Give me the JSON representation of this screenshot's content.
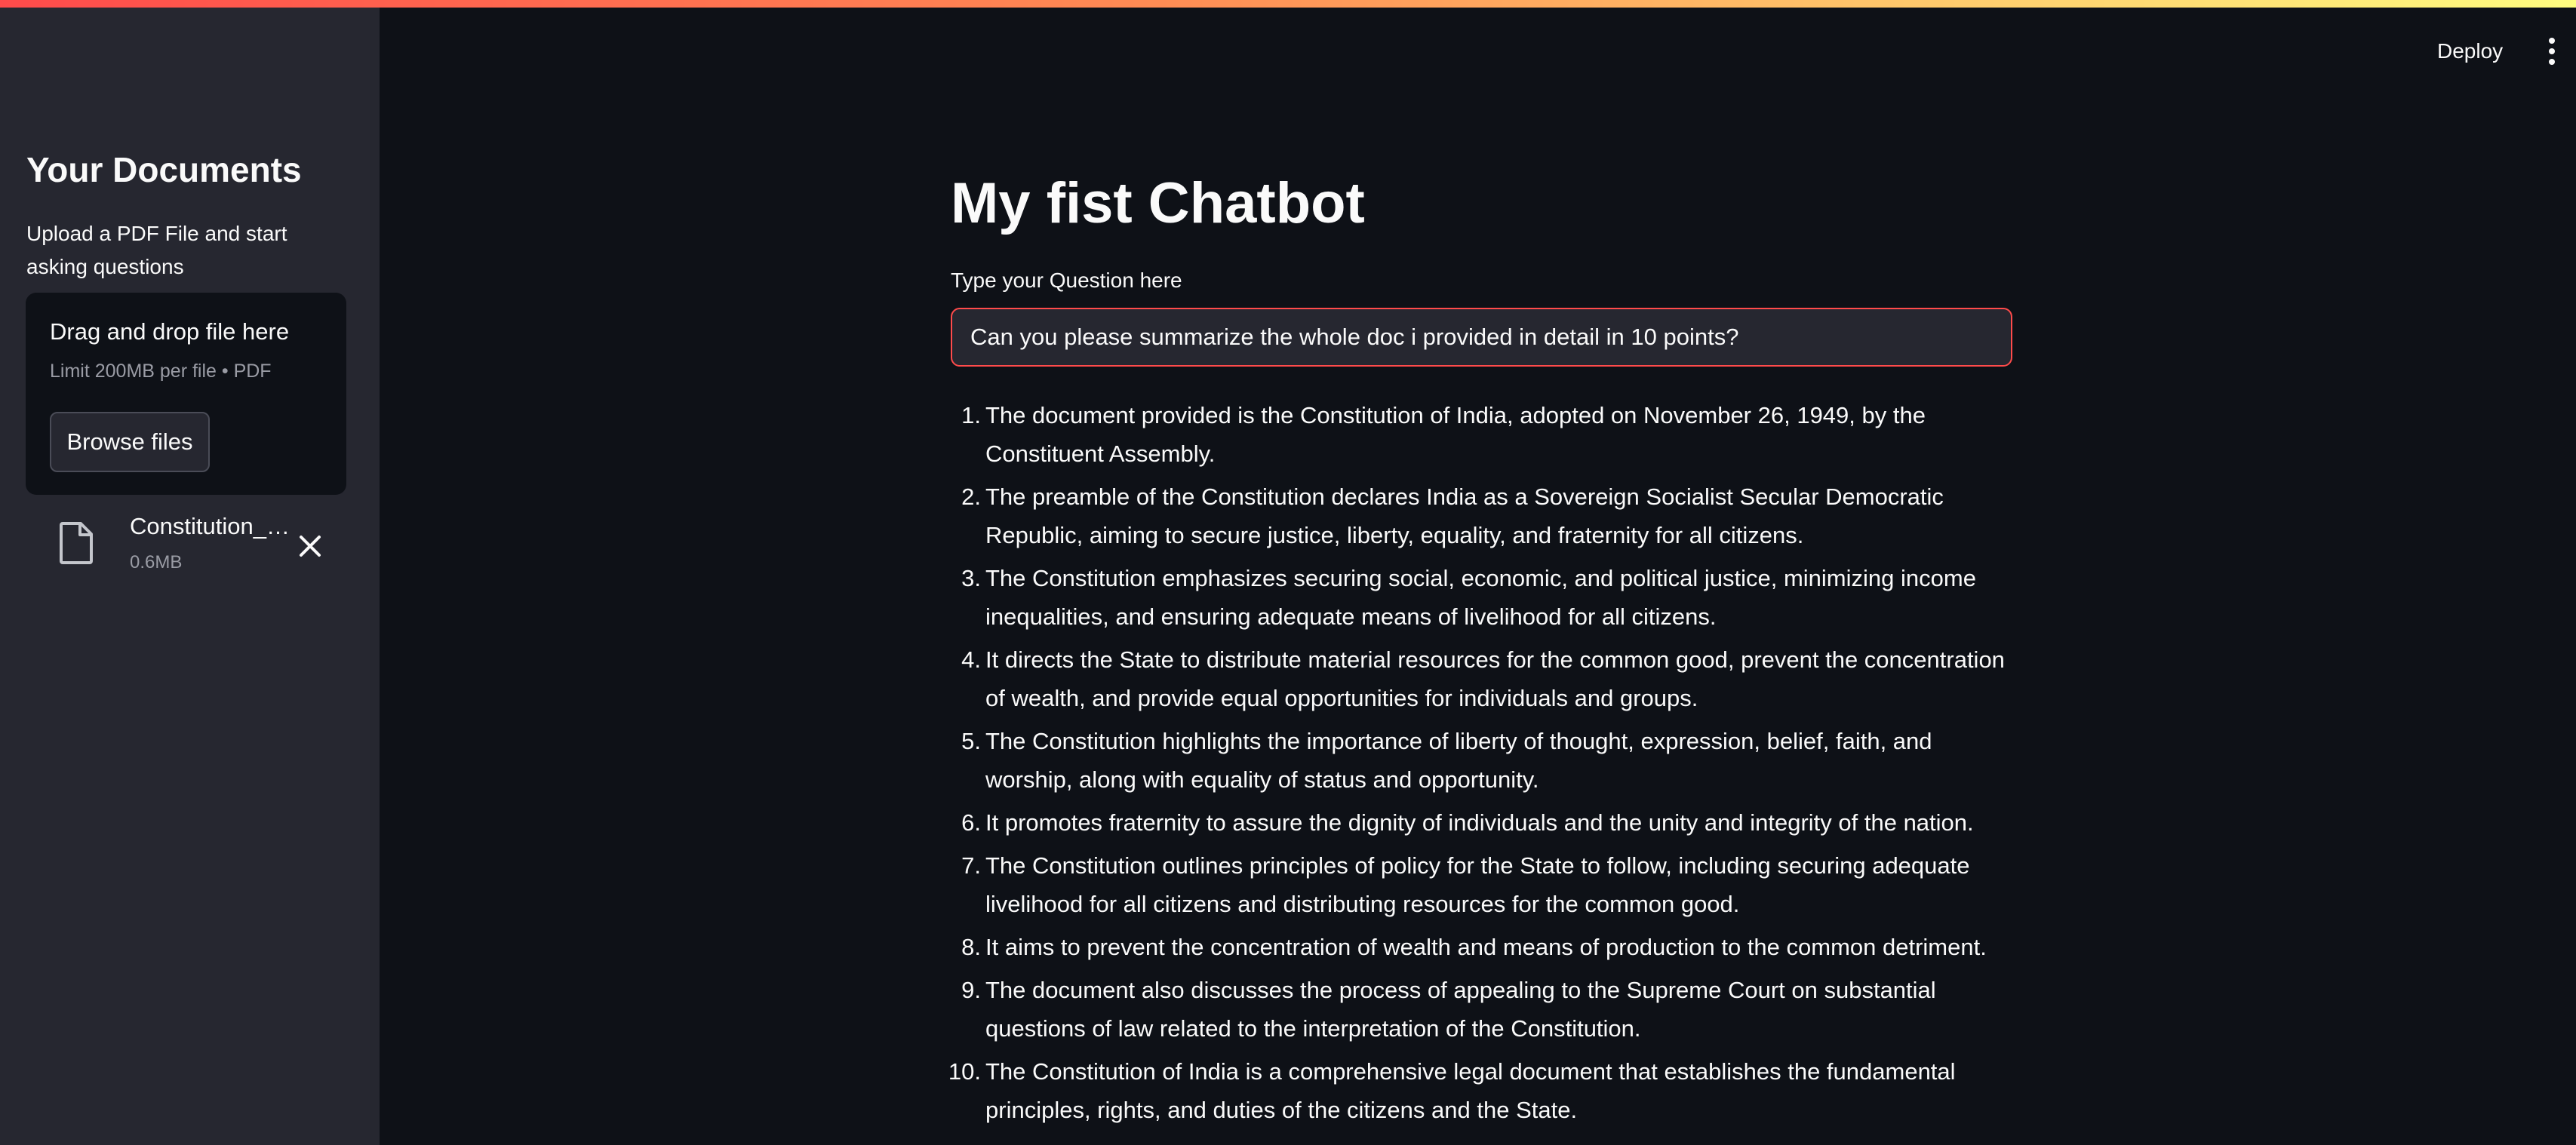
{
  "header": {
    "deploy_label": "Deploy",
    "menu_icon": "vertical-dots-icon"
  },
  "sidebar": {
    "title": "Your Documents",
    "description": "Upload a PDF File and start asking questions",
    "uploader": {
      "drop_label": "Drag and drop file here",
      "limit_label": "Limit 200MB per file • PDF",
      "browse_label": "Browse files"
    },
    "file": {
      "name": "Constitution_…",
      "size": "0.6MB",
      "icon": "file-icon",
      "remove_icon": "close-icon"
    }
  },
  "main": {
    "title": "My fist Chatbot",
    "input_label": "Type your Question here",
    "input_value": "Can you please summarize the whole doc i provided in detail in 10 points?",
    "answers": [
      {
        "num": "1.",
        "text": "The document provided is the Constitution of India, adopted on November 26, 1949, by the Constituent Assembly."
      },
      {
        "num": "2.",
        "text": "The preamble of the Constitution declares India as a Sovereign Socialist Secular Democratic Republic, aiming to secure justice, liberty, equality, and fraternity for all citizens."
      },
      {
        "num": "3.",
        "text": "The Constitution emphasizes securing social, economic, and political justice, minimizing income inequalities, and ensuring adequate means of livelihood for all citizens."
      },
      {
        "num": "4.",
        "text": "It directs the State to distribute material resources for the common good, prevent the concentration of wealth, and provide equal opportunities for individuals and groups."
      },
      {
        "num": "5.",
        "text": "The Constitution highlights the importance of liberty of thought, expression, belief, faith, and worship, along with equality of status and opportunity."
      },
      {
        "num": "6.",
        "text": "It promotes fraternity to assure the dignity of individuals and the unity and integrity of the nation."
      },
      {
        "num": "7.",
        "text": "The Constitution outlines principles of policy for the State to follow, including securing adequate livelihood for all citizens and distributing resources for the common good."
      },
      {
        "num": "8.",
        "text": "It aims to prevent the concentration of wealth and means of production to the common detriment."
      },
      {
        "num": "9.",
        "text": "The document also discusses the process of appealing to the Supreme Court on substantial questions of law related to the interpretation of the Constitution."
      },
      {
        "num": "10.",
        "text": "The Constitution of India is a comprehensive legal document that establishes the fundamental principles, rights, and duties of the citizens and the State."
      }
    ]
  },
  "colors": {
    "background": "#0e1117",
    "sidebar": "#262730",
    "accent": "#ff4b4b",
    "muted_text": "#9a9ca5"
  }
}
